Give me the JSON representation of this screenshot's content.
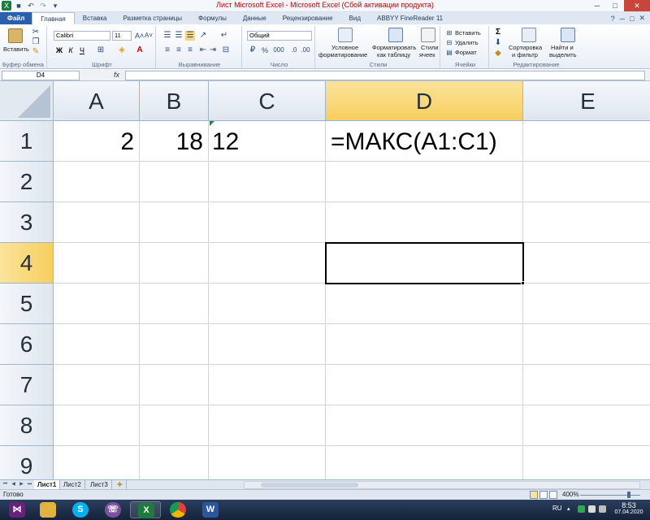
{
  "window": {
    "title": "Лист Microsoft Excel  -  Microsoft Excel (Сбой активации продукта)"
  },
  "ribbon_tabs": [
    {
      "label": "Файл"
    },
    {
      "label": "Главная"
    },
    {
      "label": "Вставка"
    },
    {
      "label": "Разметка страницы"
    },
    {
      "label": "Формулы"
    },
    {
      "label": "Данные"
    },
    {
      "label": "Рецензирование"
    },
    {
      "label": "Вид"
    },
    {
      "label": "ABBYY FineReader 11"
    }
  ],
  "ribbon": {
    "clipboard": {
      "paste_label": "Вставить",
      "group_label": "Буфер обмена"
    },
    "font": {
      "font_name": "Calibri",
      "font_size": "11",
      "group_label": "Шрифт",
      "bold": "Ж",
      "italic": "К",
      "underline": "Ч"
    },
    "alignment": {
      "group_label": "Выравнивание"
    },
    "number": {
      "format": "Общий",
      "group_label": "Число",
      "percent": "%",
      "thousands": "000"
    },
    "styles": {
      "conditional": "Условное",
      "conditional2": "форматирование",
      "as_table": "Форматировать",
      "as_table2": "как таблицу",
      "cell_styles": "Стили",
      "cell_styles2": "ячеек",
      "group_label": "Стили"
    },
    "cells": {
      "insert": "Вставить",
      "delete": "Удалить",
      "format": "Формат",
      "group_label": "Ячейки"
    },
    "editing": {
      "sort": "Сортировка",
      "sort2": "и фильтр",
      "find": "Найти и",
      "find2": "выделить",
      "group_label": "Редактирование",
      "sigma": "Σ"
    }
  },
  "formula_bar": {
    "name_box": "D4",
    "fx": "fx",
    "formula": ""
  },
  "grid": {
    "columns": [
      "A",
      "B",
      "C",
      "D",
      "E"
    ],
    "rows": [
      "1",
      "2",
      "3",
      "4",
      "5",
      "6",
      "7",
      "8",
      "9"
    ],
    "selected_column": "D",
    "selected_row": "4",
    "cells": {
      "A1": "2",
      "B1": "18",
      "C1": "12",
      "D1": "=МАКС(A1:C1)"
    }
  },
  "sheets": [
    {
      "label": "Лист1"
    },
    {
      "label": "Лист2"
    },
    {
      "label": "Лист3"
    }
  ],
  "statusbar": {
    "status": "Готово",
    "zoom": "400%"
  },
  "taskbar": {
    "lang": "RU",
    "time": "8:53",
    "date": "07.04.2020"
  }
}
